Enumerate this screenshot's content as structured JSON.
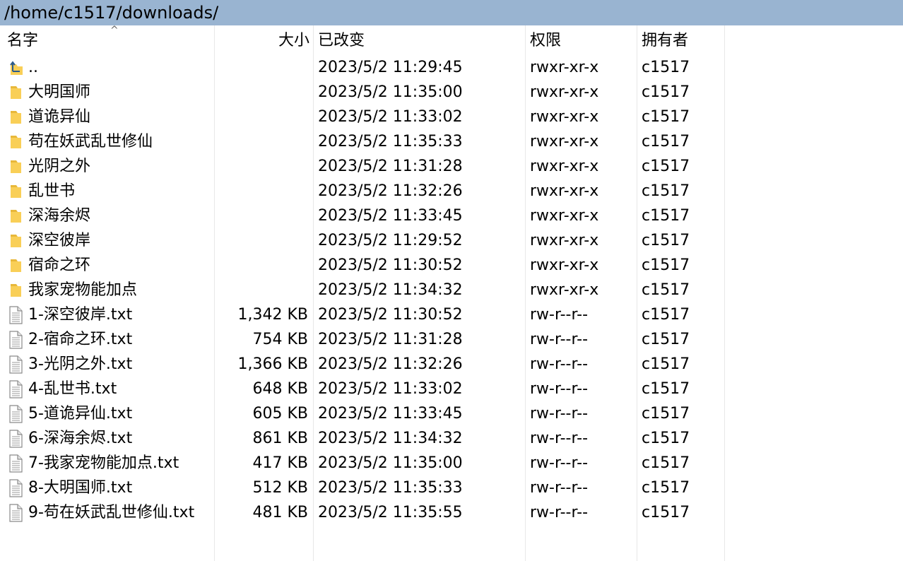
{
  "path": "/home/c1517/downloads/",
  "columns": {
    "name": "名字",
    "size": "大小",
    "modified": "已改变",
    "permissions": "权限",
    "owner": "拥有者"
  },
  "sort_indicator": "^",
  "rows": [
    {
      "icon": "parent-folder-icon",
      "name": "..",
      "size": "",
      "modified": "2023/5/2 11:29:45",
      "permissions": "rwxr-xr-x",
      "owner": "c1517"
    },
    {
      "icon": "folder-icon",
      "name": "大明国师",
      "size": "",
      "modified": "2023/5/2 11:35:00",
      "permissions": "rwxr-xr-x",
      "owner": "c1517"
    },
    {
      "icon": "folder-icon",
      "name": "道诡异仙",
      "size": "",
      "modified": "2023/5/2 11:33:02",
      "permissions": "rwxr-xr-x",
      "owner": "c1517"
    },
    {
      "icon": "folder-icon",
      "name": "苟在妖武乱世修仙",
      "size": "",
      "modified": "2023/5/2 11:35:33",
      "permissions": "rwxr-xr-x",
      "owner": "c1517"
    },
    {
      "icon": "folder-icon",
      "name": "光阴之外",
      "size": "",
      "modified": "2023/5/2 11:31:28",
      "permissions": "rwxr-xr-x",
      "owner": "c1517"
    },
    {
      "icon": "folder-icon",
      "name": "乱世书",
      "size": "",
      "modified": "2023/5/2 11:32:26",
      "permissions": "rwxr-xr-x",
      "owner": "c1517"
    },
    {
      "icon": "folder-icon",
      "name": "深海余烬",
      "size": "",
      "modified": "2023/5/2 11:33:45",
      "permissions": "rwxr-xr-x",
      "owner": "c1517"
    },
    {
      "icon": "folder-icon",
      "name": "深空彼岸",
      "size": "",
      "modified": "2023/5/2 11:29:52",
      "permissions": "rwxr-xr-x",
      "owner": "c1517"
    },
    {
      "icon": "folder-icon",
      "name": "宿命之环",
      "size": "",
      "modified": "2023/5/2 11:30:52",
      "permissions": "rwxr-xr-x",
      "owner": "c1517"
    },
    {
      "icon": "folder-icon",
      "name": "我家宠物能加点",
      "size": "",
      "modified": "2023/5/2 11:34:32",
      "permissions": "rwxr-xr-x",
      "owner": "c1517"
    },
    {
      "icon": "text-file-icon",
      "name": "1-深空彼岸.txt",
      "size": "1,342 KB",
      "modified": "2023/5/2 11:30:52",
      "permissions": "rw-r--r--",
      "owner": "c1517"
    },
    {
      "icon": "text-file-icon",
      "name": "2-宿命之环.txt",
      "size": "754 KB",
      "modified": "2023/5/2 11:31:28",
      "permissions": "rw-r--r--",
      "owner": "c1517"
    },
    {
      "icon": "text-file-icon",
      "name": "3-光阴之外.txt",
      "size": "1,366 KB",
      "modified": "2023/5/2 11:32:26",
      "permissions": "rw-r--r--",
      "owner": "c1517"
    },
    {
      "icon": "text-file-icon",
      "name": "4-乱世书.txt",
      "size": "648 KB",
      "modified": "2023/5/2 11:33:02",
      "permissions": "rw-r--r--",
      "owner": "c1517"
    },
    {
      "icon": "text-file-icon",
      "name": "5-道诡异仙.txt",
      "size": "605 KB",
      "modified": "2023/5/2 11:33:45",
      "permissions": "rw-r--r--",
      "owner": "c1517"
    },
    {
      "icon": "text-file-icon",
      "name": "6-深海余烬.txt",
      "size": "861 KB",
      "modified": "2023/5/2 11:34:32",
      "permissions": "rw-r--r--",
      "owner": "c1517"
    },
    {
      "icon": "text-file-icon",
      "name": "7-我家宠物能加点.txt",
      "size": "417 KB",
      "modified": "2023/5/2 11:35:00",
      "permissions": "rw-r--r--",
      "owner": "c1517"
    },
    {
      "icon": "text-file-icon",
      "name": "8-大明国师.txt",
      "size": "512 KB",
      "modified": "2023/5/2 11:35:33",
      "permissions": "rw-r--r--",
      "owner": "c1517"
    },
    {
      "icon": "text-file-icon",
      "name": "9-苟在妖武乱世修仙.txt",
      "size": "481 KB",
      "modified": "2023/5/2 11:35:55",
      "permissions": "rw-r--r--",
      "owner": "c1517"
    }
  ]
}
